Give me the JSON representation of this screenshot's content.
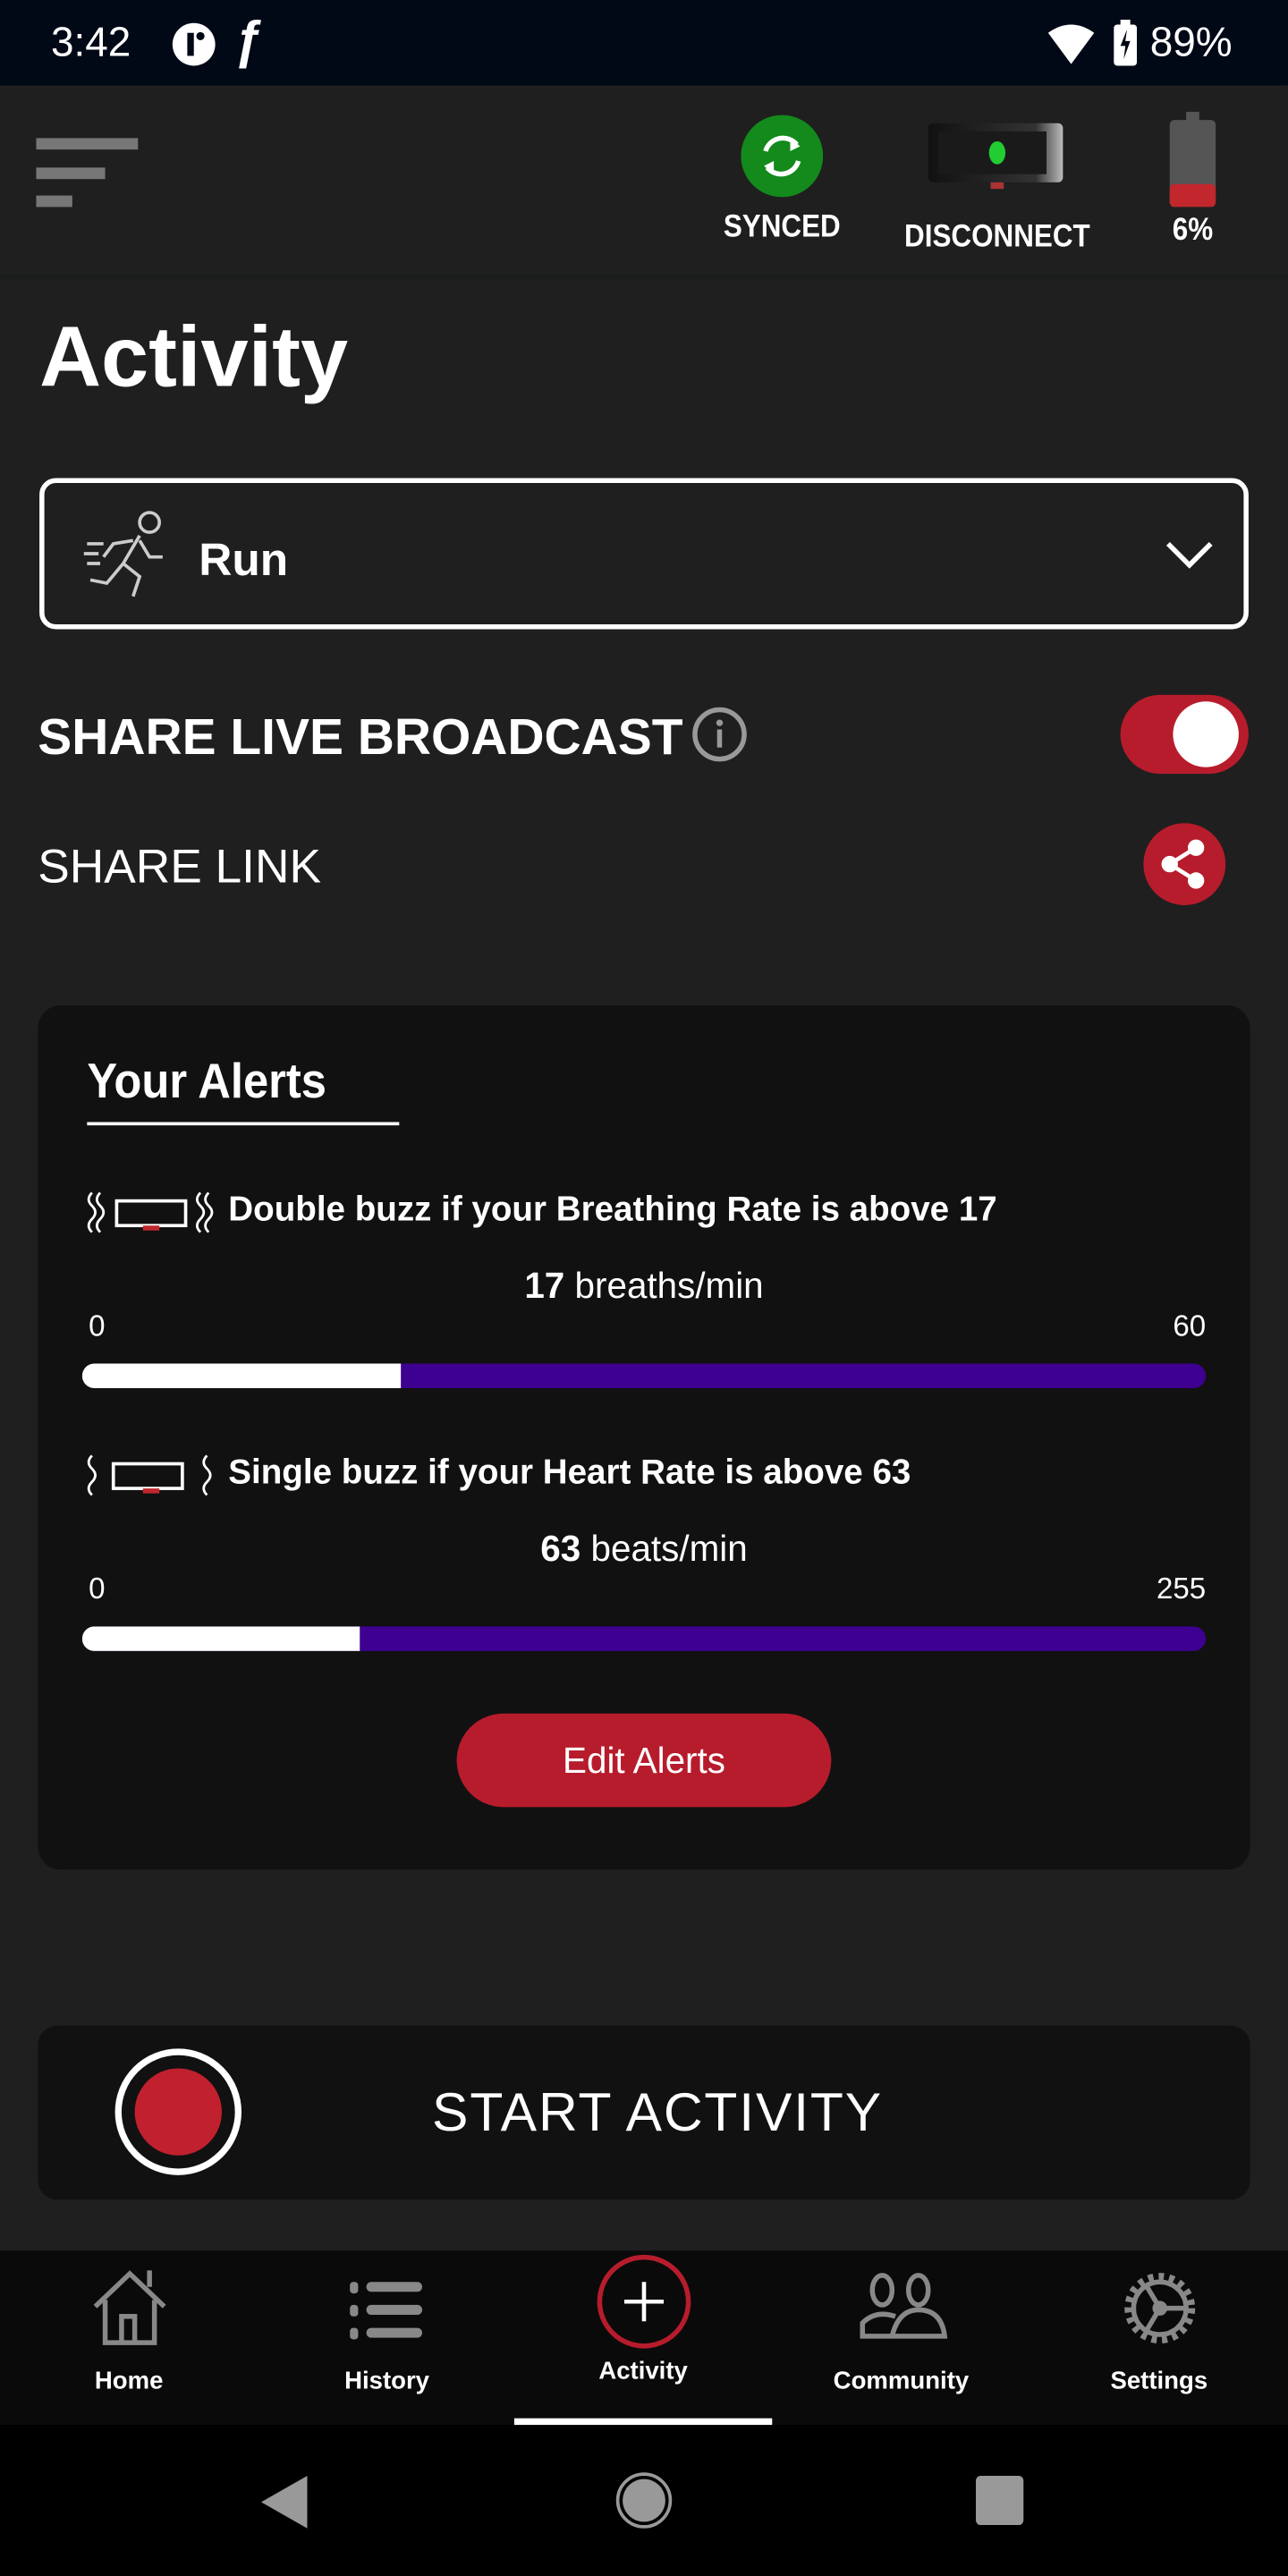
{
  "status_bar": {
    "time": "3:42",
    "battery": "89%"
  },
  "header": {
    "synced_label": "SYNCED",
    "disconnect_label": "DISCONNECT",
    "device_battery": "6%",
    "device_battery_level": 0.06,
    "synced_color": "#138a1b"
  },
  "page_title": "Activity",
  "activity_select": {
    "value": "Run"
  },
  "broadcast": {
    "label": "SHARE LIVE BROADCAST",
    "enabled": true,
    "share_link_label": "SHARE LINK"
  },
  "alerts": {
    "title": "Your Alerts",
    "items": [
      {
        "text": "Double buzz if your Breathing Rate is above 17",
        "value": "17",
        "unit": "breaths/min",
        "min": "0",
        "max": "60",
        "fraction": 0.2833
      },
      {
        "text": "Single buzz if your Heart Rate is above 63",
        "value": "63",
        "unit": "beats/min",
        "min": "0",
        "max": "255",
        "fraction": 0.247
      }
    ],
    "edit_label": "Edit Alerts"
  },
  "start_activity": {
    "label": "START ACTIVITY"
  },
  "bottom_nav": {
    "items": [
      {
        "label": "Home"
      },
      {
        "label": "History"
      },
      {
        "label": "Activity",
        "active": true
      },
      {
        "label": "Community"
      },
      {
        "label": "Settings"
      }
    ]
  },
  "colors": {
    "accent": "#b71c2c",
    "bar_track": "#3e0090",
    "card": "#111111"
  }
}
